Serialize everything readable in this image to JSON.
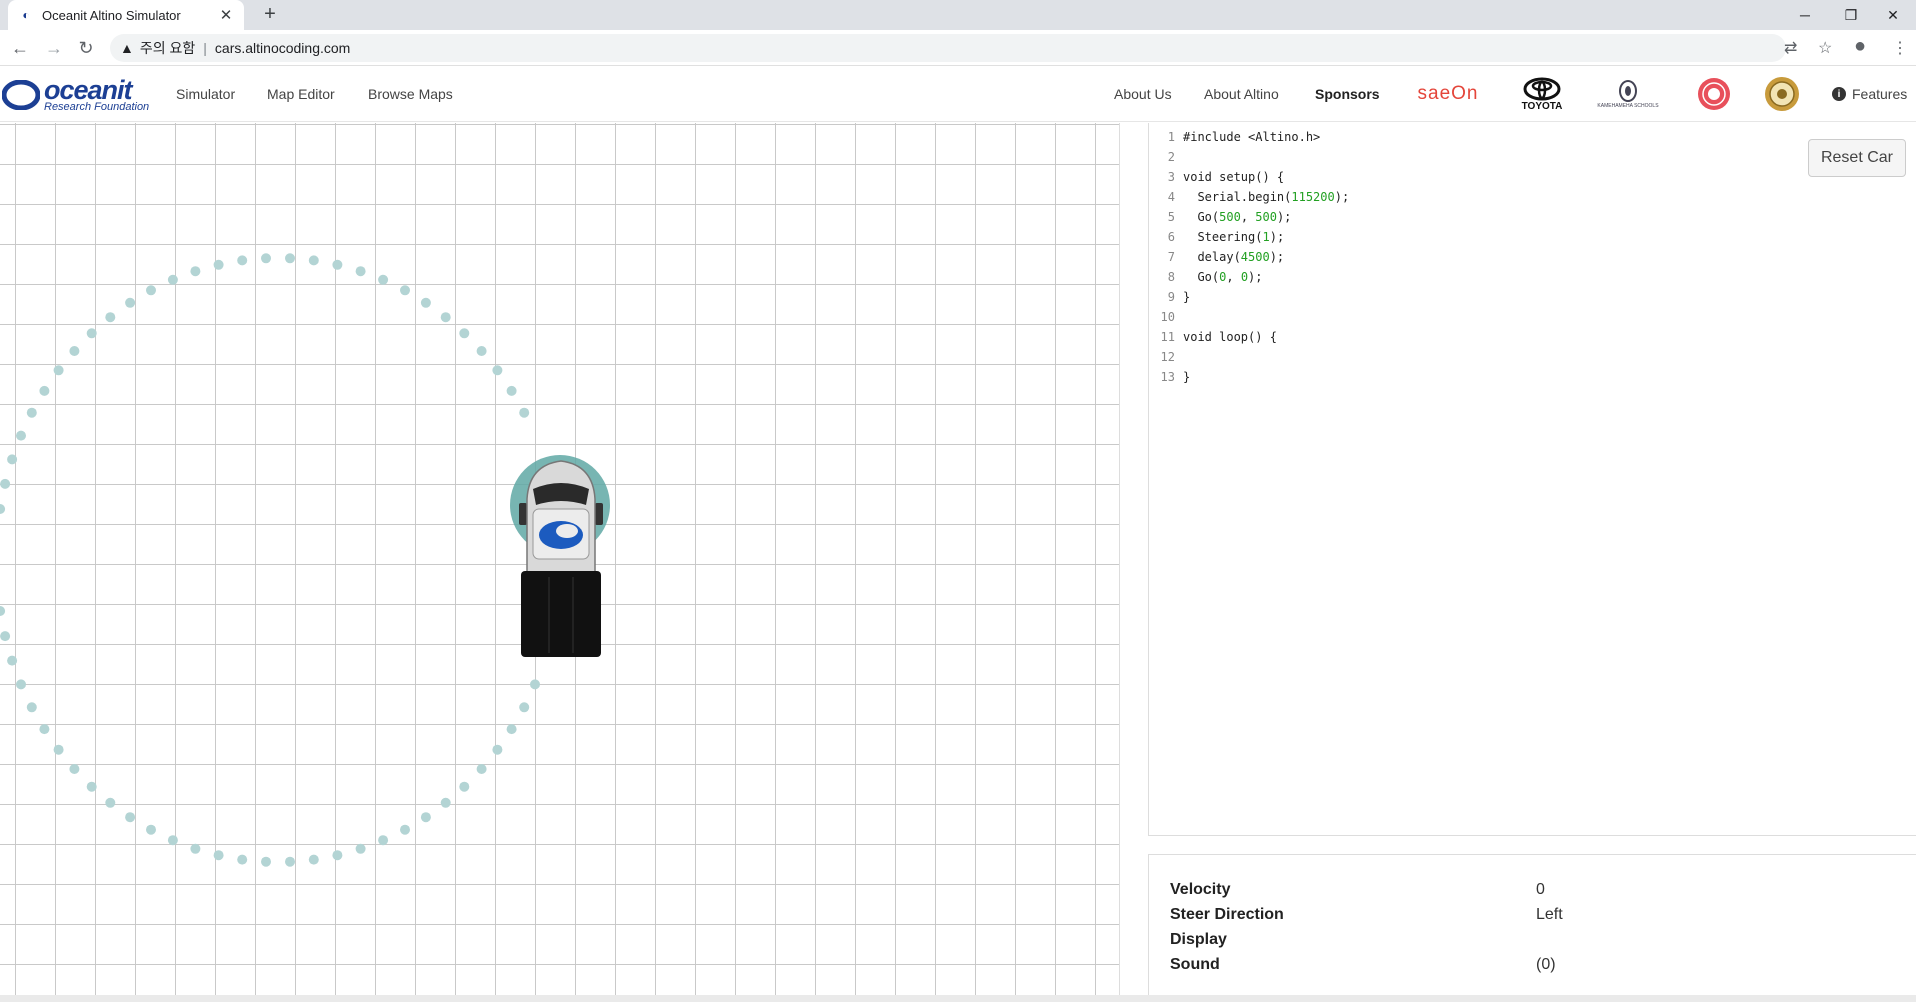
{
  "browser": {
    "tab_title": "Oceanit Altino Simulator",
    "address_warning": "주의 요함",
    "url": "cars.altinocoding.com"
  },
  "header": {
    "logo_word": "oceanit",
    "logo_sub": "Research Foundation",
    "nav": [
      "Simulator",
      "Map Editor",
      "Browse Maps"
    ],
    "right_nav": [
      "About Us",
      "About Altino",
      "Sponsors"
    ],
    "sponsors": {
      "saeon": "saeOn",
      "toyota": "TOYOTA",
      "kamehameha": "KAMEHAMEHA SCHOOLS"
    },
    "features_label": "Features"
  },
  "editor": {
    "reset_label": "Reset Car",
    "lines": [
      {
        "n": "1",
        "parts": [
          [
            "t",
            "#include <Altino.h>"
          ]
        ]
      },
      {
        "n": "2",
        "parts": []
      },
      {
        "n": "3",
        "parts": [
          [
            "t",
            "void setup() {"
          ]
        ]
      },
      {
        "n": "4",
        "parts": [
          [
            "t",
            "  Serial.begin("
          ],
          [
            "n",
            "115200"
          ],
          [
            "t",
            ");"
          ]
        ]
      },
      {
        "n": "5",
        "parts": [
          [
            "t",
            "  Go("
          ],
          [
            "n",
            "500"
          ],
          [
            "t",
            ", "
          ],
          [
            "n",
            "500"
          ],
          [
            "t",
            ");"
          ]
        ]
      },
      {
        "n": "6",
        "parts": [
          [
            "t",
            "  Steering("
          ],
          [
            "n",
            "1"
          ],
          [
            "t",
            ");"
          ]
        ]
      },
      {
        "n": "7",
        "parts": [
          [
            "t",
            "  delay("
          ],
          [
            "n",
            "4500"
          ],
          [
            "t",
            ");"
          ]
        ]
      },
      {
        "n": "8",
        "parts": [
          [
            "t",
            "  Go("
          ],
          [
            "n",
            "0"
          ],
          [
            "t",
            ", "
          ],
          [
            "n",
            "0"
          ],
          [
            "t",
            ");"
          ]
        ]
      },
      {
        "n": "9",
        "parts": [
          [
            "t",
            "}"
          ]
        ]
      },
      {
        "n": "10",
        "parts": []
      },
      {
        "n": "11",
        "parts": [
          [
            "t",
            "void loop() {"
          ]
        ]
      },
      {
        "n": "12",
        "parts": []
      },
      {
        "n": "13",
        "parts": [
          [
            "t",
            "}"
          ]
        ]
      }
    ]
  },
  "status": {
    "velocity_label": "Velocity",
    "velocity_value": "0",
    "steer_label": "Steer Direction",
    "steer_value": "Left",
    "display_label": "Display",
    "display_value": "",
    "sound_label": "Sound",
    "sound_value": "(0)"
  },
  "colors": {
    "trail": "#b3d4d4",
    "sensor": "#5fa8a4",
    "brand": "#1c3f94",
    "code_number": "#22a022"
  }
}
